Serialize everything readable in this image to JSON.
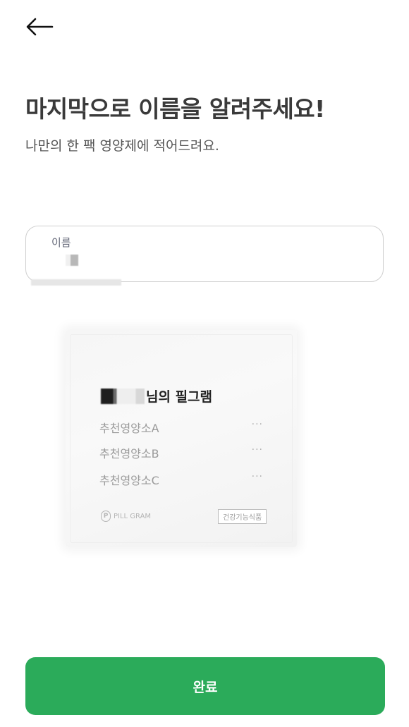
{
  "header": {
    "back_icon": "arrow-left-icon"
  },
  "title": "마지막으로 이름을 알려주세요!",
  "subtitle": "나만의 한 팩 영양제에 적어드려요.",
  "name_field": {
    "label": "이름"
  },
  "pack": {
    "owner_suffix": "님의 필그램",
    "items": [
      {
        "name": "추천영양소A",
        "amount": "···"
      },
      {
        "name": "추천영양소B",
        "amount": "···"
      },
      {
        "name": "추천영양소C",
        "amount": "···"
      }
    ],
    "brand": "PILL GRAM",
    "brand_mark": "P",
    "badge": "건강기능식품"
  },
  "complete_button": {
    "label": "완료",
    "color": "#2bab5a"
  }
}
